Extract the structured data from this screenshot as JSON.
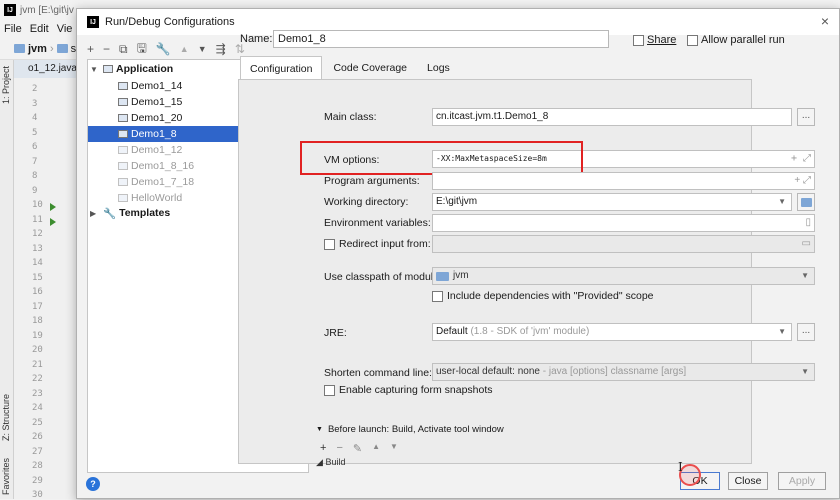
{
  "ide": {
    "title": "jvm [E:\\git\\jv",
    "menu": [
      "File",
      "Edit",
      "Vie"
    ],
    "nav_project": "jvm",
    "nav_src": "sr",
    "editor_tab": "o1_12.java",
    "side_tabs": [
      "1: Project",
      "Z: Structure",
      "Favorites"
    ],
    "line_numbers": [
      "2",
      "3",
      "4",
      "5",
      "6",
      "7",
      "8",
      "9",
      "10",
      "11",
      "12",
      "13",
      "14",
      "15",
      "16",
      "17",
      "18",
      "19",
      "20",
      "21",
      "22",
      "23",
      "24",
      "25",
      "26",
      "27",
      "28",
      "29",
      "30"
    ]
  },
  "dialog": {
    "title": "Run/Debug Configurations",
    "close": "×"
  },
  "tree": {
    "toolbar": [
      "+",
      "−",
      "⧉",
      "🖫",
      "🔧",
      "▲",
      "▼",
      "⇶",
      "⇅"
    ],
    "application": "Application",
    "items": [
      {
        "label": "Demo1_14",
        "selected": false,
        "dim": false
      },
      {
        "label": "Demo1_15",
        "selected": false,
        "dim": false
      },
      {
        "label": "Demo1_20",
        "selected": false,
        "dim": false
      },
      {
        "label": "Demo1_8",
        "selected": true,
        "dim": false
      },
      {
        "label": "Demo1_12",
        "selected": false,
        "dim": true
      },
      {
        "label": "Demo1_8_16",
        "selected": false,
        "dim": true
      },
      {
        "label": "Demo1_7_18",
        "selected": false,
        "dim": true
      },
      {
        "label": "HelloWorld",
        "selected": false,
        "dim": true
      }
    ],
    "templates": "Templates"
  },
  "header": {
    "name_label": "Name:",
    "name_value": "Demo1_8",
    "share_label": "Share",
    "parallel_label": "Allow parallel run"
  },
  "tabs": [
    "Configuration",
    "Code Coverage",
    "Logs"
  ],
  "form": {
    "main_class_label": "Main class:",
    "main_class_value": "cn.itcast.jvm.t1.Demo1_8",
    "vm_options_label": "VM options:",
    "vm_options_value": "-XX:MaxMetaspaceSize=8m",
    "program_args_label": "Program arguments:",
    "working_dir_label": "Working directory:",
    "working_dir_value": "E:\\git\\jvm",
    "env_vars_label": "Environment variables:",
    "redirect_label": "Redirect input from:",
    "classpath_label": "Use classpath of module:",
    "classpath_value": "jvm",
    "include_deps_label": "Include dependencies with \"Provided\" scope",
    "jre_label": "JRE:",
    "jre_value": "Default",
    "jre_hint": "(1.8 - SDK of 'jvm' module)",
    "shorten_label": "Shorten command line:",
    "shorten_value": "user-local default: none",
    "shorten_hint": "- java [options] classname [args]",
    "capture_label": "Enable capturing form snapshots",
    "dots": "...",
    "expand_icons": "+ ⤢"
  },
  "before_launch": {
    "title": "Before launch: Build, Activate tool window",
    "tools": [
      "+",
      "−",
      "✎",
      "▲",
      "▼"
    ],
    "item": "Build"
  },
  "buttons": {
    "help": "?",
    "ok": "OK",
    "cancel": "Close",
    "apply": "Apply"
  },
  "colors": {
    "selection": "#2f65ca",
    "highlight": "#e12222"
  }
}
